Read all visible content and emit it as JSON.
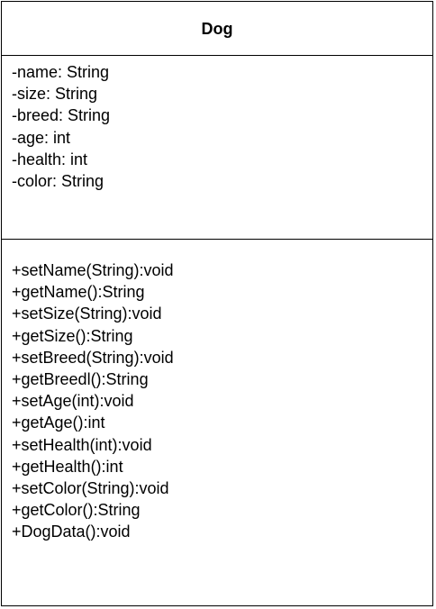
{
  "class": {
    "name": "Dog",
    "attributes": [
      "-name: String",
      "-size: String",
      "-breed: String",
      "-age: int",
      "-health: int",
      "-color: String"
    ],
    "operations": [
      "+setName(String):void",
      "+getName():String",
      "+setSize(String):void",
      "+getSize():String",
      "+setBreed(String):void",
      "+getBreedl():String",
      "+setAge(int):void",
      "+getAge():int",
      "+setHealth(int):void",
      "+getHealth():int",
      "+setColor(String):void",
      "+getColor():String",
      "+DogData():void"
    ]
  },
  "colors": {
    "border": "#000000",
    "background": "#ffffff",
    "text": "#000000"
  }
}
